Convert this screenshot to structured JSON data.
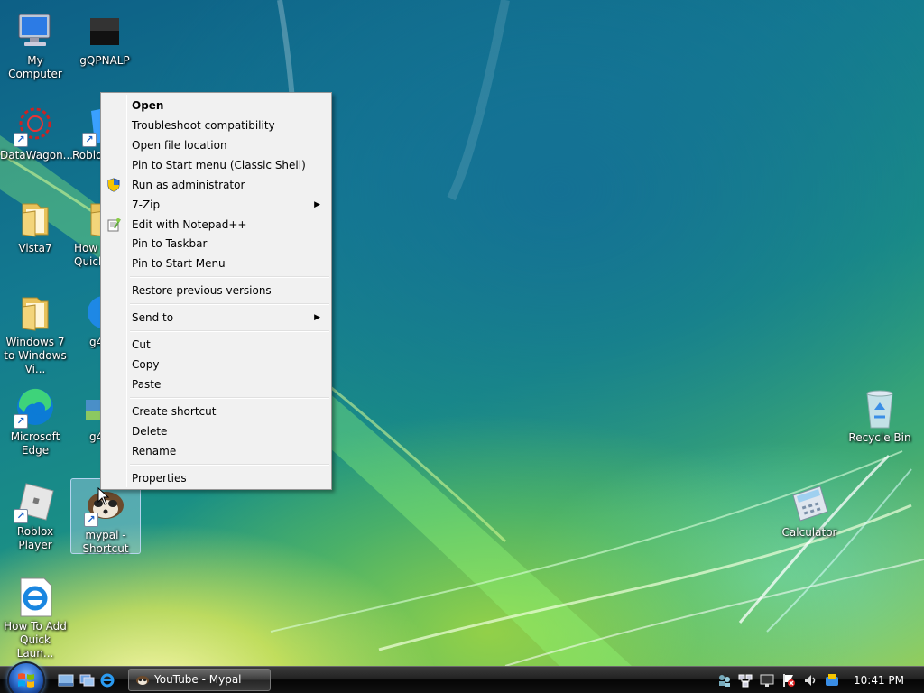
{
  "desktop": {
    "icons": [
      {
        "name": "my-computer",
        "label": "My Computer"
      },
      {
        "name": "gqpnalp",
        "label": "gQPNALP"
      },
      {
        "name": "datawagon",
        "label": "DataWagon..."
      },
      {
        "name": "roblox-2",
        "label": "Roblo"
      },
      {
        "name": "vista7",
        "label": "Vista7"
      },
      {
        "name": "how-to-quick",
        "label": "How Quick"
      },
      {
        "name": "win7-to-vista",
        "label": "Windows 7 to Windows Vi..."
      },
      {
        "name": "g4-1",
        "label": "g4"
      },
      {
        "name": "microsoft-edge",
        "label": "Microsoft Edge"
      },
      {
        "name": "g4-2",
        "label": "g4"
      },
      {
        "name": "roblox-player",
        "label": "Roblox Player"
      },
      {
        "name": "mypal-shortcut",
        "label": "mypal - Shortcut"
      },
      {
        "name": "how-to-add-quick-launch",
        "label": "How To Add Quick Laun..."
      },
      {
        "name": "recycle-bin",
        "label": "Recycle Bin"
      },
      {
        "name": "calculator",
        "label": "Calculator"
      }
    ]
  },
  "context_menu": {
    "items": [
      {
        "label": "Open",
        "bold": true
      },
      {
        "label": "Troubleshoot compatibility"
      },
      {
        "label": "Open file location"
      },
      {
        "label": "Pin to Start menu (Classic Shell)"
      },
      {
        "label": "Run as administrator",
        "icon": "shield-icon"
      },
      {
        "label": "7-Zip",
        "submenu": true
      },
      {
        "label": "Edit with Notepad++",
        "icon": "notepad-plus-plus-icon"
      },
      {
        "label": "Pin to Taskbar"
      },
      {
        "label": "Pin to Start Menu"
      },
      {
        "label": "Restore previous versions"
      },
      {
        "label": "Send to",
        "submenu": true
      },
      {
        "label": "Cut"
      },
      {
        "label": "Copy"
      },
      {
        "label": "Paste"
      },
      {
        "label": "Create shortcut"
      },
      {
        "label": "Delete"
      },
      {
        "label": "Rename"
      },
      {
        "label": "Properties"
      }
    ],
    "submenu_arrow": "▶"
  },
  "taskbar": {
    "running_task": "YouTube - Mypal",
    "clock": "10:41 PM"
  }
}
